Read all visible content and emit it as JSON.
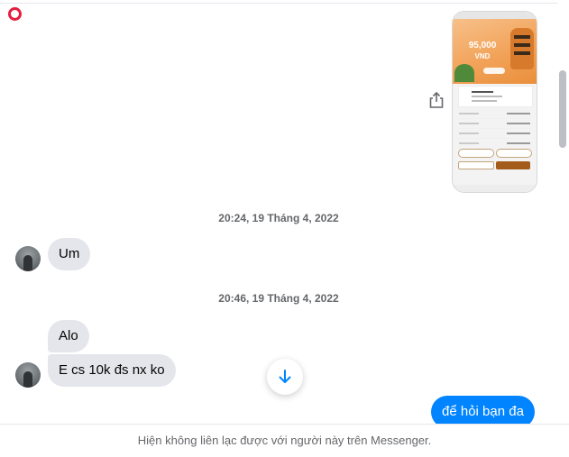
{
  "shared_image": {
    "amount": "95,000",
    "currency": "VND"
  },
  "timestamps": [
    "20:24, 19 Tháng 4, 2022",
    "20:46, 19 Tháng 4, 2022"
  ],
  "messages": {
    "um": "Um",
    "alo": "Alo",
    "ecs": "E cs 10k đs nx ko",
    "outgoing_partial": "để hỏi bạn đa"
  },
  "footer": {
    "notice": "Hiện không liên lạc được với người này trên Messenger."
  },
  "colors": {
    "accent": "#0084ff",
    "bubble_gray": "#e4e6eb",
    "muted_text": "#65676b"
  },
  "icons": {
    "share": "share-icon",
    "scroll_down": "arrow-down-icon"
  }
}
